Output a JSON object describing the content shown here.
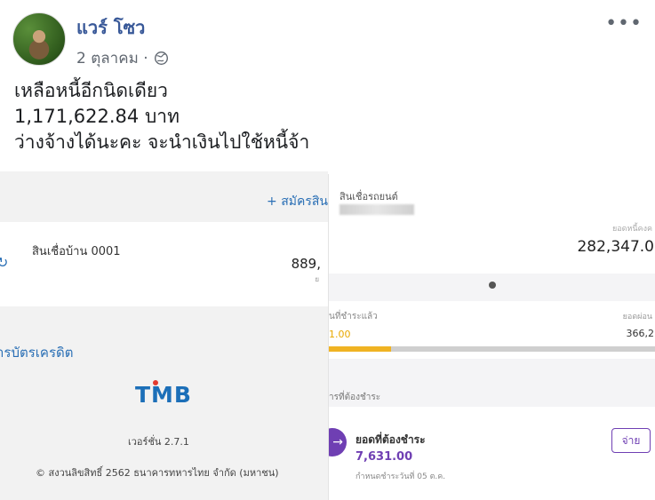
{
  "post": {
    "author": "แวร์ โซว",
    "date": "2 ตุลาคม ·",
    "more": "•••",
    "caption": [
      "เหลือหนี้อีกนิดเดียว",
      "1,171,622.84 บาท",
      "ว่างจ้างได้นะคะ จะนำเงินไปใช้หนี้จ้า"
    ]
  },
  "left_screenshot": {
    "apply_link": "+ สมัครสิน",
    "loan_title": "สินเชื่อบ้าน 0001",
    "loan_amount": "889,",
    "loan_amount_sub": "ย",
    "loan_icon": "↻",
    "credit_link": "ารบัตรเครดิต",
    "logo": "TMB",
    "version": "เวอร์ชั่น 2.7.1",
    "copyright": "© สงวนลิขสิทธิ์ 2562 ธนาคารทหารไทย จำกัด (มหาชน)"
  },
  "right_screenshot": {
    "car_title": "สินเชื่อรถยนต์",
    "outstanding_label": "ยอดหนี้คงค",
    "outstanding_value": "282,347.0",
    "paid_label": "นที่ชำระแล้ว",
    "paid_value": "1.00",
    "paid_right_label": "ยอดผ่อน",
    "paid_right_value": "366,2",
    "progress_fraction": 0.19,
    "due_section_label": "ารที่ต้องชำระ",
    "due_title": "ยอดที่ต้องชำระ",
    "due_amount": "7,631.00",
    "due_date": "กำหนดชำระวันที่ 05 ต.ค.",
    "pay_button": "จ่าย"
  },
  "colors": {
    "name_link": "#385898",
    "tmb_blue": "#1c6fb8",
    "purple": "#6f3fb3",
    "progress": "#f0b323"
  }
}
